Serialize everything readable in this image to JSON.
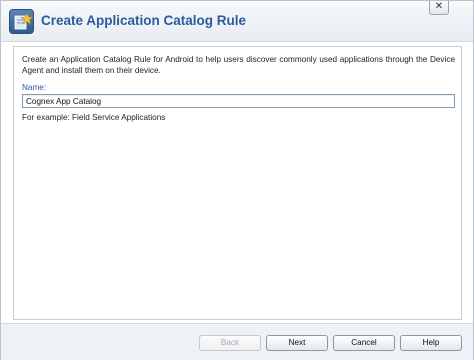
{
  "window": {
    "title": "Create Application Catalog Rule",
    "close_glyph": "✕"
  },
  "icons": {
    "title": "catalog-star-icon",
    "close": "close-icon"
  },
  "content": {
    "description": "Create an Application Catalog Rule for Android to help users discover commonly used applications through the Device Agent and install them on their device.",
    "name_label": "Name:",
    "name_value": "Cognex App Catalog",
    "example_text": "For example: Field Service Applications"
  },
  "footer": {
    "back_label": "Back",
    "next_label": "Next",
    "cancel_label": "Cancel",
    "help_label": "Help"
  },
  "colors": {
    "title_text": "#2a5b9c",
    "label_text": "#2a5b9c",
    "input_border": "#7f9db9"
  }
}
